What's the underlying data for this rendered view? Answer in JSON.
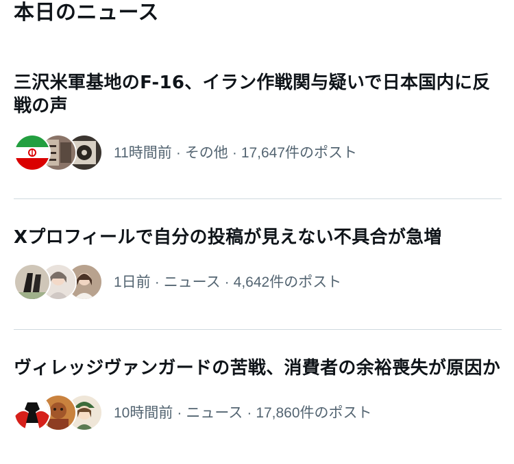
{
  "section": {
    "title": "本日のニュース"
  },
  "news": [
    {
      "headline": "三沢米軍基地のF-16、イラン作戦関与疑いで日本国内に反戦の声",
      "time": "11時間前",
      "category": "その他",
      "posts": "17,647件のポスト"
    },
    {
      "headline": "Xプロフィールで自分の投稿が見えない不具合が急増",
      "time": "1日前",
      "category": "ニュース",
      "posts": "4,642件のポスト"
    },
    {
      "headline": "ヴィレッジヴァンガードの苦戦、消費者の余裕喪失が原因か",
      "time": "10時間前",
      "category": "ニュース",
      "posts": "17,860件のポスト"
    }
  ],
  "separator": "·",
  "colors": {
    "text_primary": "#0f1419",
    "text_secondary": "#536471",
    "divider": "#cfd9de",
    "background": "#ffffff"
  }
}
